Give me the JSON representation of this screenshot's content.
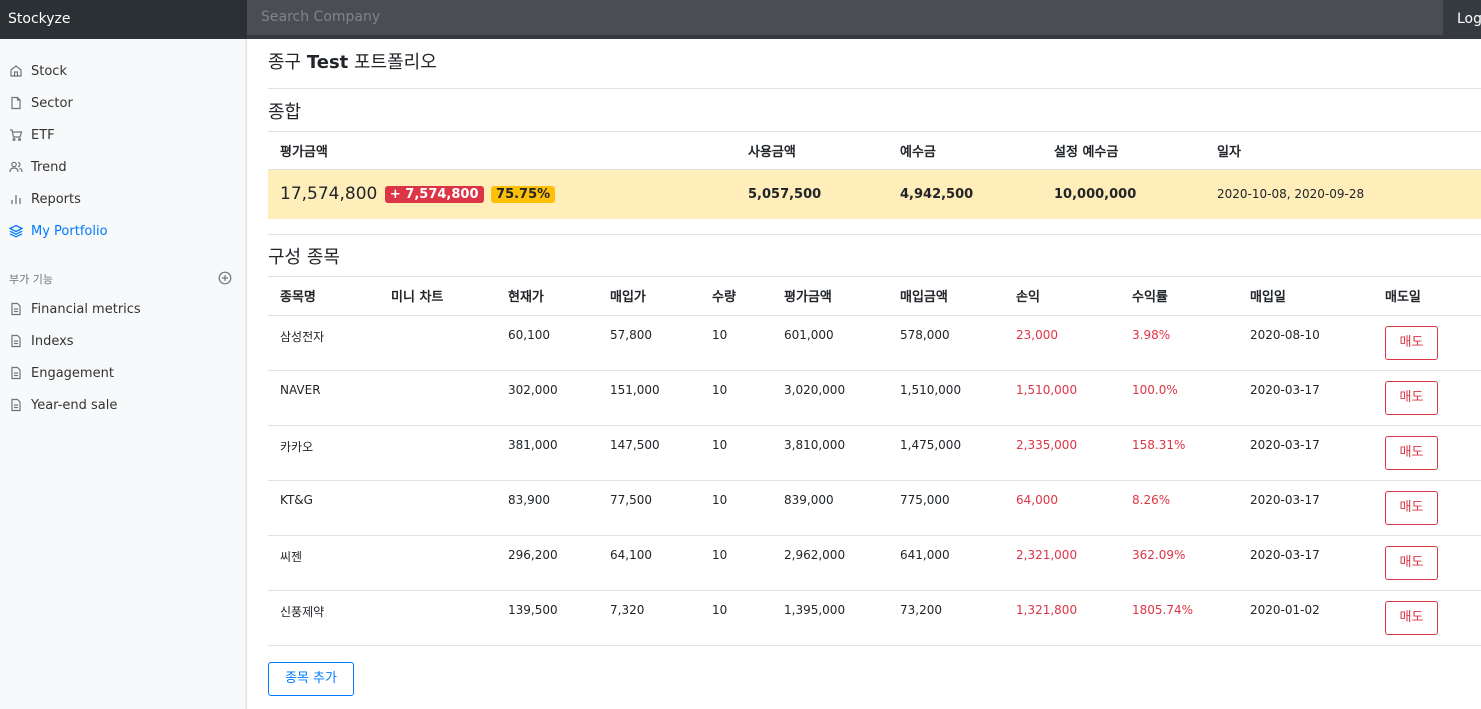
{
  "app": {
    "brand": "Stockyze"
  },
  "search": {
    "placeholder": "Search Company"
  },
  "header": {
    "logout_label": "Logout"
  },
  "sidebar": {
    "items": [
      {
        "label": "Stock",
        "icon": "home-icon"
      },
      {
        "label": "Sector",
        "icon": "file-icon"
      },
      {
        "label": "ETF",
        "icon": "cart-icon"
      },
      {
        "label": "Trend",
        "icon": "users-icon"
      },
      {
        "label": "Reports",
        "icon": "bar-chart-icon"
      },
      {
        "label": "My Portfolio",
        "icon": "layers-icon",
        "active": true
      }
    ],
    "section_heading": "부가 기능",
    "extra_items": [
      {
        "label": "Financial metrics",
        "icon": "file-text-icon"
      },
      {
        "label": "Indexs",
        "icon": "file-text-icon"
      },
      {
        "label": "Engagement",
        "icon": "file-text-icon"
      },
      {
        "label": "Year-end sale",
        "icon": "file-text-icon"
      }
    ]
  },
  "page": {
    "title_prefix": "종구 ",
    "title_bold": "Test",
    "title_suffix": " 포트폴리오"
  },
  "summary": {
    "title": "종합",
    "headers": [
      "평가금액",
      "사용금액",
      "예수금",
      "설정 예수금",
      "일자"
    ],
    "evaluation": "17,574,800",
    "gain_badge": "+ 7,574,800",
    "rate_badge": "75.75%",
    "used": "5,057,500",
    "deposit": "4,942,500",
    "set_deposit": "10,000,000",
    "dates": "2020-10-08, 2020-09-28"
  },
  "holdings": {
    "title": "구성 종목",
    "headers": [
      "종목명",
      "미니 차트",
      "현재가",
      "매입가",
      "수량",
      "평가금액",
      "매입금액",
      "손익",
      "수익률",
      "매입일",
      "매도일"
    ],
    "sell_label": "매도",
    "rows": [
      {
        "name": "삼성전자",
        "chart": "",
        "current": "60,100",
        "buy": "57,800",
        "qty": "10",
        "eval": "601,000",
        "cost": "578,000",
        "pnl": "23,000",
        "rate": "3.98%",
        "date": "2020-08-10"
      },
      {
        "name": "NAVER",
        "chart": "",
        "current": "302,000",
        "buy": "151,000",
        "qty": "10",
        "eval": "3,020,000",
        "cost": "1,510,000",
        "pnl": "1,510,000",
        "rate": "100.0%",
        "date": "2020-03-17"
      },
      {
        "name": "카카오",
        "chart": "",
        "current": "381,000",
        "buy": "147,500",
        "qty": "10",
        "eval": "3,810,000",
        "cost": "1,475,000",
        "pnl": "2,335,000",
        "rate": "158.31%",
        "date": "2020-03-17"
      },
      {
        "name": "KT&G",
        "chart": "",
        "current": "83,900",
        "buy": "77,500",
        "qty": "10",
        "eval": "839,000",
        "cost": "775,000",
        "pnl": "64,000",
        "rate": "8.26%",
        "date": "2020-03-17"
      },
      {
        "name": "씨젠",
        "chart": "",
        "current": "296,200",
        "buy": "64,100",
        "qty": "10",
        "eval": "2,962,000",
        "cost": "641,000",
        "pnl": "2,321,000",
        "rate": "362.09%",
        "date": "2020-03-17"
      },
      {
        "name": "신풍제약",
        "chart": "",
        "current": "139,500",
        "buy": "7,320",
        "qty": "10",
        "eval": "1,395,000",
        "cost": "73,200",
        "pnl": "1,321,800",
        "rate": "1805.74%",
        "date": "2020-01-02"
      }
    ],
    "add_label": "종목 추가"
  },
  "colors": {
    "accent": "#007bff",
    "danger": "#dc3545",
    "warning": "#ffc107",
    "highlight_row": "#ffeeba",
    "navbar": "#343a40"
  }
}
